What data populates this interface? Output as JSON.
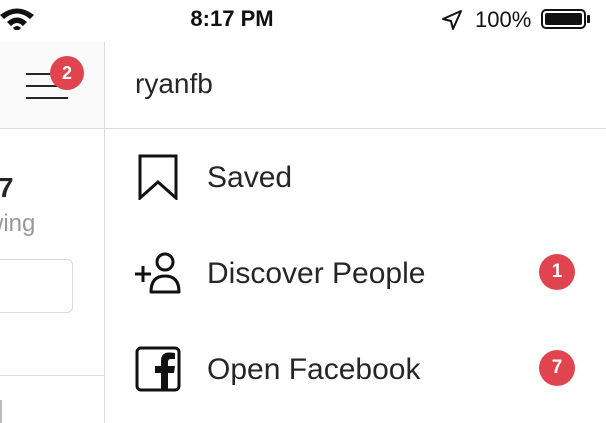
{
  "status_bar": {
    "time": "8:17 PM",
    "battery_percent": "100%",
    "icons": [
      "wifi-icon",
      "location-arrow-icon",
      "battery-icon"
    ]
  },
  "left_panel": {
    "menu_badge": "2",
    "following_count": "7",
    "following_label": "wing"
  },
  "menu": {
    "username": "ryanfb",
    "items": [
      {
        "label": "Saved",
        "icon": "bookmark-icon",
        "badge": ""
      },
      {
        "label": "Discover People",
        "icon": "add-person-icon",
        "badge": "1"
      },
      {
        "label": "Open Facebook",
        "icon": "facebook-icon",
        "badge": "7"
      }
    ]
  },
  "colors": {
    "badge": "#e0454f",
    "divider": "#dbdbdb",
    "text": "#262626",
    "muted_text": "#999999"
  }
}
